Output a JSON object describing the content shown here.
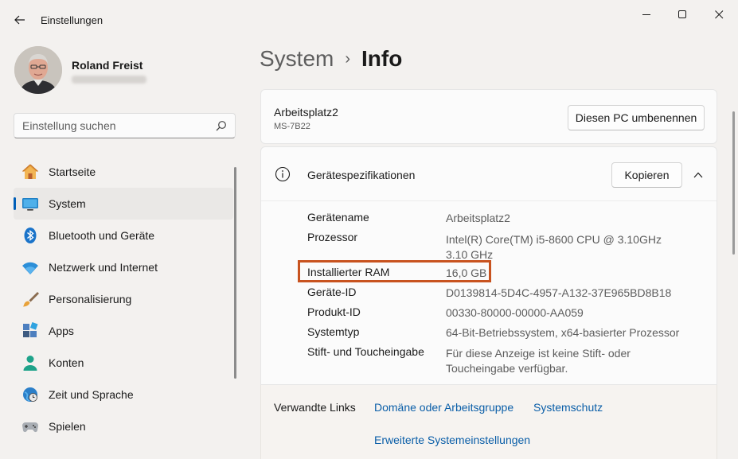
{
  "window": {
    "title": "Einstellungen"
  },
  "user": {
    "name": "Roland Freist"
  },
  "search": {
    "placeholder": "Einstellung suchen"
  },
  "nav": {
    "items": [
      {
        "label": "Startseite",
        "icon": "home-icon"
      },
      {
        "label": "System",
        "icon": "system-icon",
        "active": true
      },
      {
        "label": "Bluetooth und Geräte",
        "icon": "bluetooth-icon"
      },
      {
        "label": "Netzwerk und Internet",
        "icon": "wifi-icon"
      },
      {
        "label": "Personalisierung",
        "icon": "brush-icon"
      },
      {
        "label": "Apps",
        "icon": "apps-icon"
      },
      {
        "label": "Konten",
        "icon": "account-icon"
      },
      {
        "label": "Zeit und Sprache",
        "icon": "clock-globe-icon"
      },
      {
        "label": "Spielen",
        "icon": "gamepad-icon"
      }
    ]
  },
  "breadcrumb": {
    "parent": "System",
    "separator": "›",
    "current": "Info"
  },
  "pc": {
    "name": "Arbeitsplatz2",
    "model": "MS-7B22",
    "rename_label": "Diesen PC umbenennen"
  },
  "specs": {
    "title": "Gerätespezifikationen",
    "copy_label": "Kopieren",
    "rows": [
      {
        "label": "Gerätename",
        "value": "Arbeitsplatz2"
      },
      {
        "label": "Prozessor",
        "value": "Intel(R) Core(TM) i5-8600 CPU @ 3.10GHz   3.10 GHz"
      },
      {
        "label": "Installierter RAM",
        "value": "16,0 GB"
      },
      {
        "label": "Geräte-ID",
        "value": "D0139814-5D4C-4957-A132-37E965BD8B18"
      },
      {
        "label": "Produkt-ID",
        "value": "00330-80000-00000-AA059"
      },
      {
        "label": "Systemtyp",
        "value": "64-Bit-Betriebssystem, x64-basierter Prozessor"
      },
      {
        "label": "Stift- und Toucheingabe",
        "value": "Für diese Anzeige ist keine Stift- oder Toucheingabe verfügbar."
      }
    ]
  },
  "related": {
    "title": "Verwandte Links",
    "links": [
      "Domäne oder Arbeitsgruppe",
      "Systemschutz",
      "Erweiterte Systemeinstellungen"
    ]
  },
  "colors": {
    "accent": "#005fb8",
    "highlight_box": "#c8531f",
    "link": "#0a5ea8"
  }
}
